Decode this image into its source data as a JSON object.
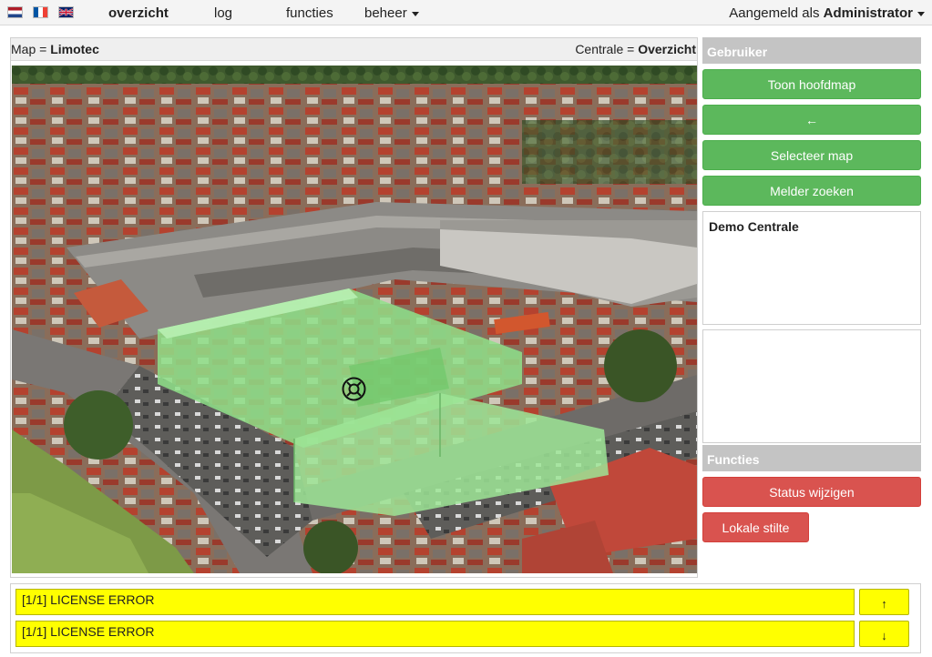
{
  "nav": {
    "languages": [
      {
        "code": "nl",
        "icon": "flag-nl-icon"
      },
      {
        "code": "fr",
        "icon": "flag-fr-icon"
      },
      {
        "code": "en",
        "icon": "flag-gb-icon"
      }
    ],
    "items": [
      {
        "label": "overzicht",
        "active": true
      },
      {
        "label": "log"
      },
      {
        "label": "functies"
      },
      {
        "label": "beheer",
        "dropdown": true
      }
    ],
    "user_prefix": "Aangemeld als",
    "user_name": "Administrator"
  },
  "map": {
    "title_prefix": "Map = ",
    "title_value": "Limotec",
    "centrale_prefix": "Centrale = ",
    "centrale_value": "Overzicht",
    "marker_icon": "detector-marker-icon"
  },
  "sidebar": {
    "gebruiker_header": "Gebruiker",
    "buttons": [
      {
        "label": "Toon hoofdmap"
      },
      {
        "label": "←"
      },
      {
        "label": "Selecteer map"
      },
      {
        "label": "Melder zoeken"
      }
    ],
    "centrale_box_title": "Demo Centrale",
    "functies_header": "Functies",
    "status_button": "Status wijzigen",
    "silence_button": "Lokale stilte"
  },
  "alarms": {
    "rows": [
      {
        "text": "[1/1] LICENSE ERROR"
      },
      {
        "text": "[1/1] LICENSE ERROR"
      }
    ],
    "up_label": "↑",
    "down_label": "↓"
  },
  "colors": {
    "green_button": "#5cb85c",
    "red_button": "#d9534f",
    "alarm_yellow": "#ffff00",
    "header_gray": "#c4c4c4",
    "zone_green": "#8fe08a"
  }
}
